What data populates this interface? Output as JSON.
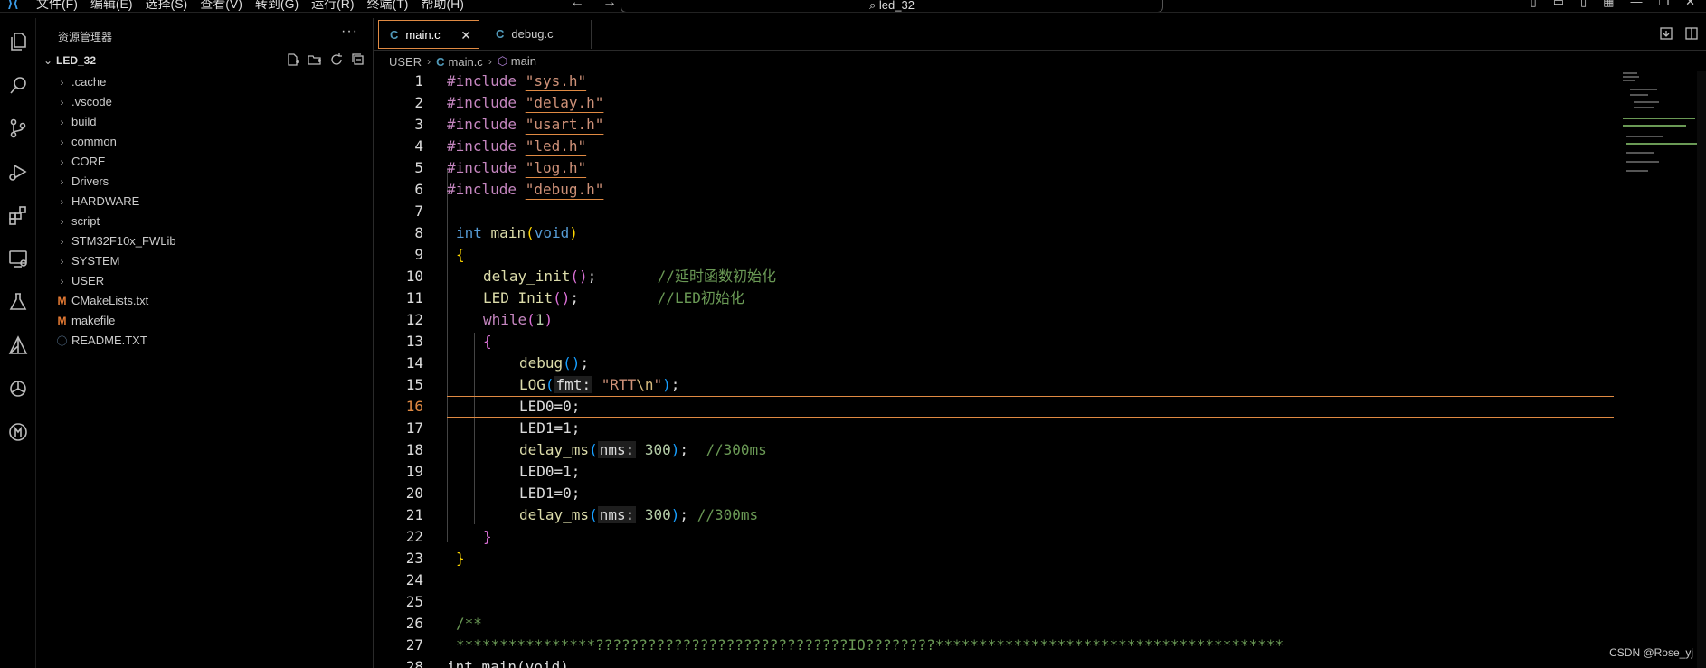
{
  "titlebar": {
    "menu": [
      "文件(F)",
      "编辑(E)",
      "选择(S)",
      "查看(V)",
      "转到(G)",
      "运行(R)",
      "终端(T)",
      "帮助(H)"
    ],
    "search_text": "led_32"
  },
  "sidebar": {
    "title": "资源管理器",
    "root_folder": "LED_32",
    "items": [
      {
        "label": ".cache",
        "type": "folder"
      },
      {
        "label": ".vscode",
        "type": "folder"
      },
      {
        "label": "build",
        "type": "folder"
      },
      {
        "label": "common",
        "type": "folder"
      },
      {
        "label": "CORE",
        "type": "folder"
      },
      {
        "label": "Drivers",
        "type": "folder"
      },
      {
        "label": "HARDWARE",
        "type": "folder"
      },
      {
        "label": "script",
        "type": "folder"
      },
      {
        "label": "STM32F10x_FWLib",
        "type": "folder"
      },
      {
        "label": "SYSTEM",
        "type": "folder"
      },
      {
        "label": "USER",
        "type": "folder"
      },
      {
        "label": "CMakeLists.txt",
        "type": "cmake"
      },
      {
        "label": "makefile",
        "type": "makefile"
      },
      {
        "label": "README.TXT",
        "type": "info"
      }
    ]
  },
  "tabs": [
    {
      "label": "main.c",
      "active": true
    },
    {
      "label": "debug.c",
      "active": false
    }
  ],
  "breadcrumb": {
    "folder": "USER",
    "file": "main.c",
    "symbol": "main"
  },
  "editor": {
    "current_line": 16,
    "include_kw": "#include",
    "includes": [
      "\"sys.h\"",
      "\"delay.h\"",
      "\"usart.h\"",
      "\"led.h\"",
      "\"log.h\"",
      "\"debug.h\""
    ],
    "int_kw": "int",
    "main_fn": "main",
    "void_kw": "void",
    "delay_init": "delay_init",
    "led_init": "LED_Init",
    "comment_delay": "//延时函数初始化",
    "comment_led": "//LED初始化",
    "while_kw": "while",
    "while_arg": "1",
    "debug_fn": "debug",
    "log_fn": "LOG",
    "fmt_hint": "fmt:",
    "log_str": "\"RTT",
    "log_esc": "\\n",
    "log_str_end": "\"",
    "led0_on": "LED0=0;",
    "led1_on": "LED1=1;",
    "delay_ms": "delay_ms",
    "nms_hint": "nms:",
    "delay_val": "300",
    "comment_300_a": "//300ms",
    "led0_off": "LED0=1;",
    "led1_off": "LED1=0;",
    "comment_300_b": "//300ms",
    "doc_open": "/**",
    "doc_stars": "****************?????????????????????????????IO????????****************************************",
    "line28": "int main(void)"
  },
  "watermark": "CSDN @Rose_yj"
}
